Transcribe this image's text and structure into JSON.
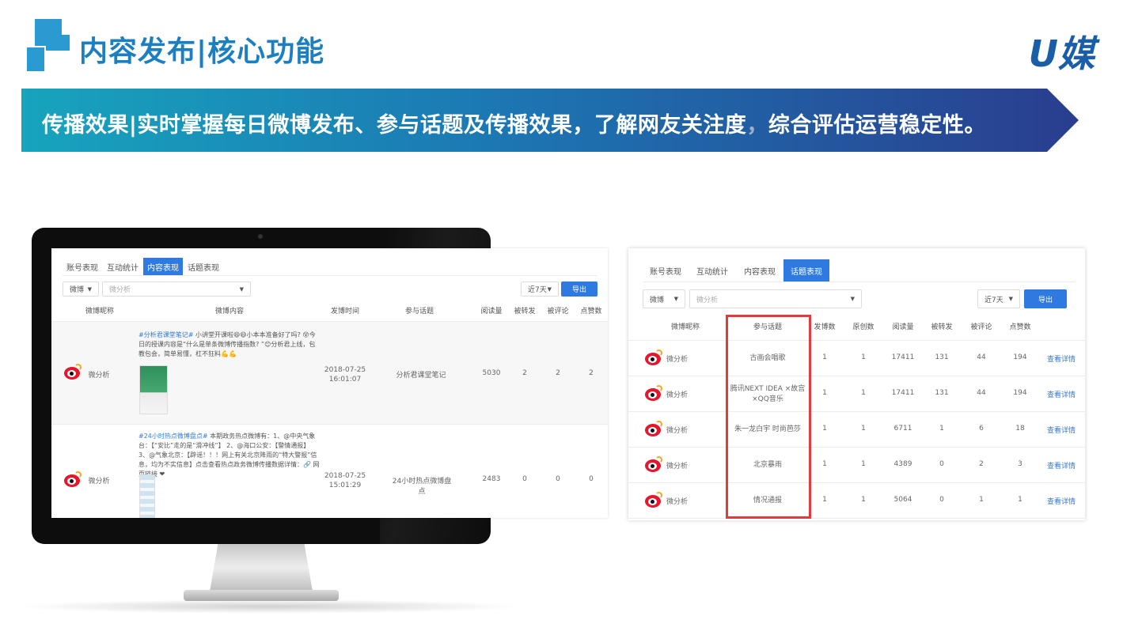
{
  "header": {
    "title": "内容发布|核心功能",
    "brand": "U媒"
  },
  "banner": {
    "text_main": "传播效果|实时掌握每日微博发布、参与话题及传播效果，了解网友关注度",
    "text_comma": "，",
    "text_tail": "综合评估运营稳定性。"
  },
  "colors": {
    "title_blue": "#1b7fc0",
    "primary_button": "#2e7ae0",
    "highlight_red": "#e23b3b",
    "weibo_red": "#e6162d"
  },
  "left_screen": {
    "tabs": [
      {
        "label": "账号表现",
        "active": false
      },
      {
        "label": "互动统计",
        "active": false
      },
      {
        "label": "内容表现",
        "active": true
      },
      {
        "label": "话题表现",
        "active": false
      }
    ],
    "platform_select": "微博",
    "account_select_placeholder": "微分析",
    "range_select": "近7天",
    "export_label": "导出",
    "columns": [
      "微博昵称",
      "微博内容",
      "发博时间",
      "参与话题",
      "阅读量",
      "被转发",
      "被评论",
      "点赞数"
    ],
    "rows": [
      {
        "nickname": "微分析",
        "content_tag": "#分析君课堂笔记#",
        "content": "小讲堂开课啦😄😄小本本准备好了吗? 😵今日的授课内容是“什么是单条微博传播指数? ”😊分析君上线，包教包会，简单易懂，杠不狂料💪💪",
        "time": "2018-07-25 16:01:07",
        "topic": "分析君课堂笔记",
        "reads": "5030",
        "reposts": "2",
        "comments": "2",
        "likes": "2"
      },
      {
        "nickname": "微分析",
        "content_tag": "#24小时热点微博盘点#",
        "content": "本期政务热点微博有：1、@中央气象台：【“安比”走的是“滑冲线”】 2、@海口公安：【警情通报】 3、@气象北京：【辟谣！！！网上有关北京降雨的“特大警报”信息，均为不实信息】点击查看热点政务微博传播数据详情：🔗 网页链接 ❤",
        "time": "2018-07-25 15:01:29",
        "topic": "24小时热点微博盘点",
        "reads": "2483",
        "reposts": "0",
        "comments": "0",
        "likes": "0"
      }
    ]
  },
  "right_screen": {
    "tabs": [
      {
        "label": "账号表现",
        "active": false
      },
      {
        "label": "互动统计",
        "active": false
      },
      {
        "label": "内容表现",
        "active": false
      },
      {
        "label": "话题表现",
        "active": true
      }
    ],
    "platform_select": "微博",
    "account_select_placeholder": "微分析",
    "range_select": "近7天",
    "export_label": "导出",
    "columns": [
      "微博昵称",
      "参与话题",
      "发博数",
      "原创数",
      "阅读量",
      "被转发",
      "被评论",
      "点赞数"
    ],
    "detail_label": "查看详情",
    "rows": [
      {
        "nickname": "微分析",
        "topic": "古画会唱歌",
        "posts": "1",
        "original": "1",
        "reads": "17411",
        "reposts": "131",
        "comments": "44",
        "likes": "194"
      },
      {
        "nickname": "微分析",
        "topic": "腾讯NEXT IDEA ×故宫×QQ音乐",
        "posts": "1",
        "original": "1",
        "reads": "17411",
        "reposts": "131",
        "comments": "44",
        "likes": "194"
      },
      {
        "nickname": "微分析",
        "topic": "朱一龙白宇 时尚芭莎",
        "posts": "1",
        "original": "1",
        "reads": "6711",
        "reposts": "1",
        "comments": "6",
        "likes": "18"
      },
      {
        "nickname": "微分析",
        "topic": "北京暴雨",
        "posts": "1",
        "original": "1",
        "reads": "4389",
        "reposts": "0",
        "comments": "2",
        "likes": "3"
      },
      {
        "nickname": "微分析",
        "topic": "情况通报",
        "posts": "1",
        "original": "1",
        "reads": "5064",
        "reposts": "0",
        "comments": "1",
        "likes": "1"
      }
    ]
  }
}
